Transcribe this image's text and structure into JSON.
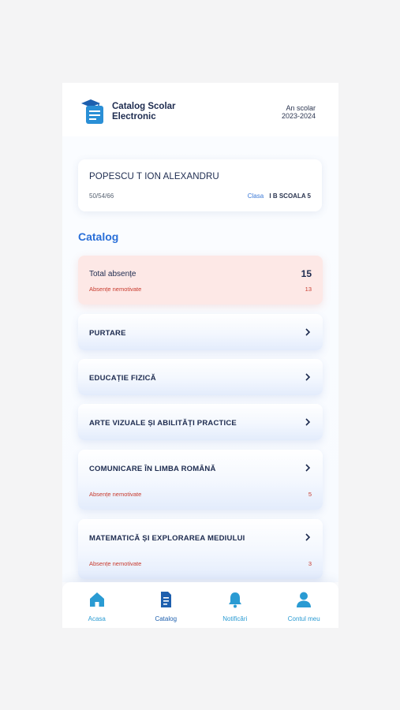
{
  "header": {
    "app_title_line1": "Catalog Scolar",
    "app_title_line2": "Electronic",
    "year_label": "An scolar",
    "year_value": "2023-2024"
  },
  "student": {
    "name": "POPESCU T ION ALEXANDRU",
    "code": "50/54/66",
    "class_label": "Clasa",
    "class_value": "I B SCOALA 5"
  },
  "section_title": "Catalog",
  "absences": {
    "title": "Total absențe",
    "total": "15",
    "unmotivated_label": "Absențe nemotivate",
    "unmotivated_count": "13"
  },
  "subjects": [
    {
      "name": "PURTARE",
      "unmotivated_label": "",
      "unmotivated_count": ""
    },
    {
      "name": "EDUCAȚIE FIZICĂ",
      "unmotivated_label": "",
      "unmotivated_count": ""
    },
    {
      "name": "ARTE VIZUALE ȘI ABILITĂȚI PRACTICE",
      "unmotivated_label": "",
      "unmotivated_count": ""
    },
    {
      "name": "COMUNICARE ÎN LIMBA ROMÂNĂ",
      "unmotivated_label": "Absențe nemotivate",
      "unmotivated_count": "5"
    },
    {
      "name": "MATEMATICĂ ȘI EXPLORAREA MEDIULUI",
      "unmotivated_label": "Absențe nemotivate",
      "unmotivated_count": "3"
    }
  ],
  "nav": {
    "home": "Acasa",
    "catalog": "Catalog",
    "notifications": "Notificări",
    "account": "Contul meu"
  },
  "colors": {
    "accent": "#2a6fd8",
    "nav_icon": "#2a9bd3",
    "alert": "#c83a2d",
    "absence_bg": "#fde8e6"
  },
  "icons": {
    "logo": "graduation-cap-document-icon",
    "chevron": "chevron-right-icon",
    "home": "home-icon",
    "catalog": "document-icon",
    "notifications": "bell-icon",
    "account": "user-icon"
  }
}
